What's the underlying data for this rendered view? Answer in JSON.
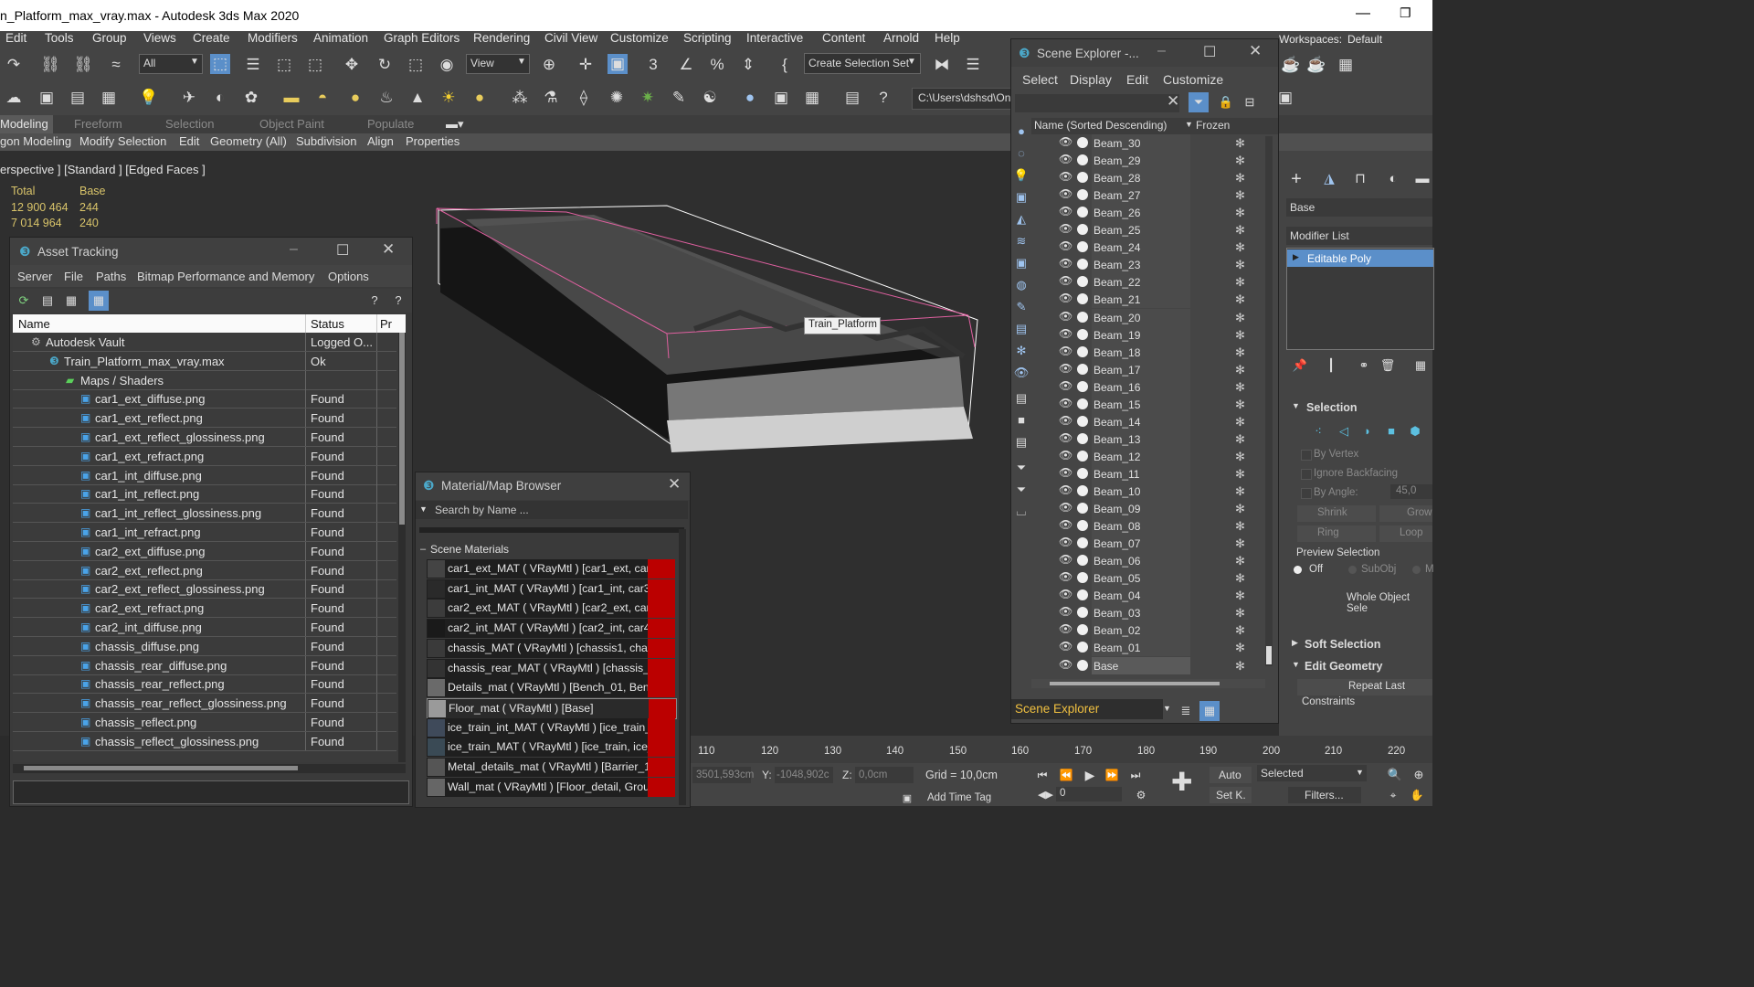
{
  "window": {
    "title": "n_Platform_max_vray.max - Autodesk 3ds Max 2020"
  },
  "menubar": {
    "items": [
      "Edit",
      "Tools",
      "Group",
      "Views",
      "Create",
      "Modifiers",
      "Animation",
      "Graph Editors",
      "Rendering",
      "Civil View",
      "Customize",
      "Scripting",
      "Interactive",
      "Content",
      "Arnold",
      "Help"
    ],
    "workspaces_label": "Workspaces:",
    "workspace_value": "Default"
  },
  "toolbar": {
    "filter_value": "All",
    "view_value": "View",
    "selection_set": "Create Selection Set",
    "path_value": "C:\\Users\\dshsd\\One"
  },
  "ribbon": {
    "tabs": [
      "Modeling",
      "Freeform",
      "Selection",
      "Object Paint",
      "Populate"
    ],
    "subtabs": [
      "gon Modeling",
      "Modify Selection",
      "Edit",
      "Geometry (All)",
      "Subdivision",
      "Align",
      "Properties"
    ]
  },
  "viewport": {
    "label": "erspective ] [Standard ] [Edged Faces ]",
    "stats_head_total": "Total",
    "stats_head_base": "Base",
    "stats_row1_total": "12 900 464",
    "stats_row1_base": "244",
    "stats_row2_total": "7 014 964",
    "stats_row2_base": "240",
    "object_tooltip": "Train_Platform"
  },
  "asset_tracking": {
    "title": "Asset Tracking",
    "menu": [
      "Server",
      "File",
      "Paths",
      "Bitmap Performance and Memory",
      "Options"
    ],
    "col_name": "Name",
    "col_status": "Status",
    "col_pr": "Pr",
    "rows": [
      {
        "name": "Autodesk Vault",
        "status": "Logged O..."
      },
      {
        "name": "Train_Platform_max_vray.max",
        "status": "Ok"
      },
      {
        "name": "Maps / Shaders",
        "status": ""
      },
      {
        "name": "car1_ext_diffuse.png",
        "status": "Found"
      },
      {
        "name": "car1_ext_reflect.png",
        "status": "Found"
      },
      {
        "name": "car1_ext_reflect_glossiness.png",
        "status": "Found"
      },
      {
        "name": "car1_ext_refract.png",
        "status": "Found"
      },
      {
        "name": "car1_int_diffuse.png",
        "status": "Found"
      },
      {
        "name": "car1_int_reflect.png",
        "status": "Found"
      },
      {
        "name": "car1_int_reflect_glossiness.png",
        "status": "Found"
      },
      {
        "name": "car1_int_refract.png",
        "status": "Found"
      },
      {
        "name": "car2_ext_diffuse.png",
        "status": "Found"
      },
      {
        "name": "car2_ext_reflect.png",
        "status": "Found"
      },
      {
        "name": "car2_ext_reflect_glossiness.png",
        "status": "Found"
      },
      {
        "name": "car2_ext_refract.png",
        "status": "Found"
      },
      {
        "name": "car2_int_diffuse.png",
        "status": "Found"
      },
      {
        "name": "chassis_diffuse.png",
        "status": "Found"
      },
      {
        "name": "chassis_rear_diffuse.png",
        "status": "Found"
      },
      {
        "name": "chassis_rear_reflect.png",
        "status": "Found"
      },
      {
        "name": "chassis_rear_reflect_glossiness.png",
        "status": "Found"
      },
      {
        "name": "chassis_reflect.png",
        "status": "Found"
      },
      {
        "name": "chassis_reflect_glossiness.png",
        "status": "Found"
      }
    ]
  },
  "material_browser": {
    "title": "Material/Map Browser",
    "search_placeholder": "Search by Name ...",
    "section": "Scene Materials",
    "materials": [
      "car1_ext_MAT  ( VRayMtl )  [car1_ext, car1_e...",
      "car1_int_MAT  ( VRayMtl )  [car1_int, car3_int...",
      "car2_ext_MAT  ( VRayMtl )  [car2_ext, car2_e...",
      "car2_int_MAT  ( VRayMtl )  [car2_int, car4_int...",
      "chassis_MAT  ( VRayMtl )  [chassis1, chassis2,...",
      "chassis_rear_MAT  ( VRayMtl )  [chassis_rear...",
      "Details_mat  ( VRayMtl )  [Bench_01, Bench_...",
      "Floor_mat  ( VRayMtl )  [Base]",
      "ice_train_int_MAT  ( VRayMtl )  [ice_train_int,...",
      "ice_train_MAT  ( VRayMtl )  [ice_train, ice_trai...",
      "Metal_details_mat  ( VRayMtl )  [Barrier_1, Ba...",
      "Wall_mat  ( VRayMtl )  [Floor_detail, Ground_..."
    ]
  },
  "scene_explorer": {
    "title": "Scene Explorer -...",
    "menu": [
      "Select",
      "Display",
      "Edit",
      "Customize"
    ],
    "col_name": "Name (Sorted Descending)",
    "col_frozen": "Frozen",
    "items": [
      "Beam_30",
      "Beam_29",
      "Beam_28",
      "Beam_27",
      "Beam_26",
      "Beam_25",
      "Beam_24",
      "Beam_23",
      "Beam_22",
      "Beam_21",
      "Beam_20",
      "Beam_19",
      "Beam_18",
      "Beam_17",
      "Beam_16",
      "Beam_15",
      "Beam_14",
      "Beam_13",
      "Beam_12",
      "Beam_11",
      "Beam_10",
      "Beam_09",
      "Beam_08",
      "Beam_07",
      "Beam_06",
      "Beam_05",
      "Beam_04",
      "Beam_03",
      "Beam_02",
      "Beam_01",
      "Base"
    ],
    "footer_label": "Scene Explorer"
  },
  "command_panel": {
    "object_name": "Base",
    "modifier_list": "Modifier List",
    "modifier": "Editable Poly",
    "selection_header": "Selection",
    "by_vertex": "By Vertex",
    "ignore_backfacing": "Ignore Backfacing",
    "by_angle": "By Angle:",
    "angle_value": "45,0",
    "shrink": "Shrink",
    "grow": "Grow",
    "ring": "Ring",
    "loop": "Loop",
    "preview_selection": "Preview Selection",
    "off": "Off",
    "subobj": "SubObj",
    "m": "M",
    "whole_object": "Whole Object Sele",
    "soft_selection": "Soft Selection",
    "edit_geometry": "Edit Geometry",
    "repeat_last": "Repeat Last",
    "constraints": "Constraints"
  },
  "timeline": {
    "ticks": [
      "110",
      "120",
      "130",
      "140",
      "150",
      "160",
      "170",
      "180",
      "190",
      "200",
      "210",
      "220"
    ]
  },
  "statusbar": {
    "x_value": "3501,593cm",
    "y_label": "Y:",
    "y_value": "-1048,902c",
    "z_label": "Z:",
    "z_value": "0,0cm",
    "grid": "Grid = 10,0cm",
    "auto": "Auto",
    "selected": "Selected",
    "setk": "Set K.",
    "filters": "Filters...",
    "add_time_tag": "Add Time Tag",
    "frame_value": "0"
  }
}
